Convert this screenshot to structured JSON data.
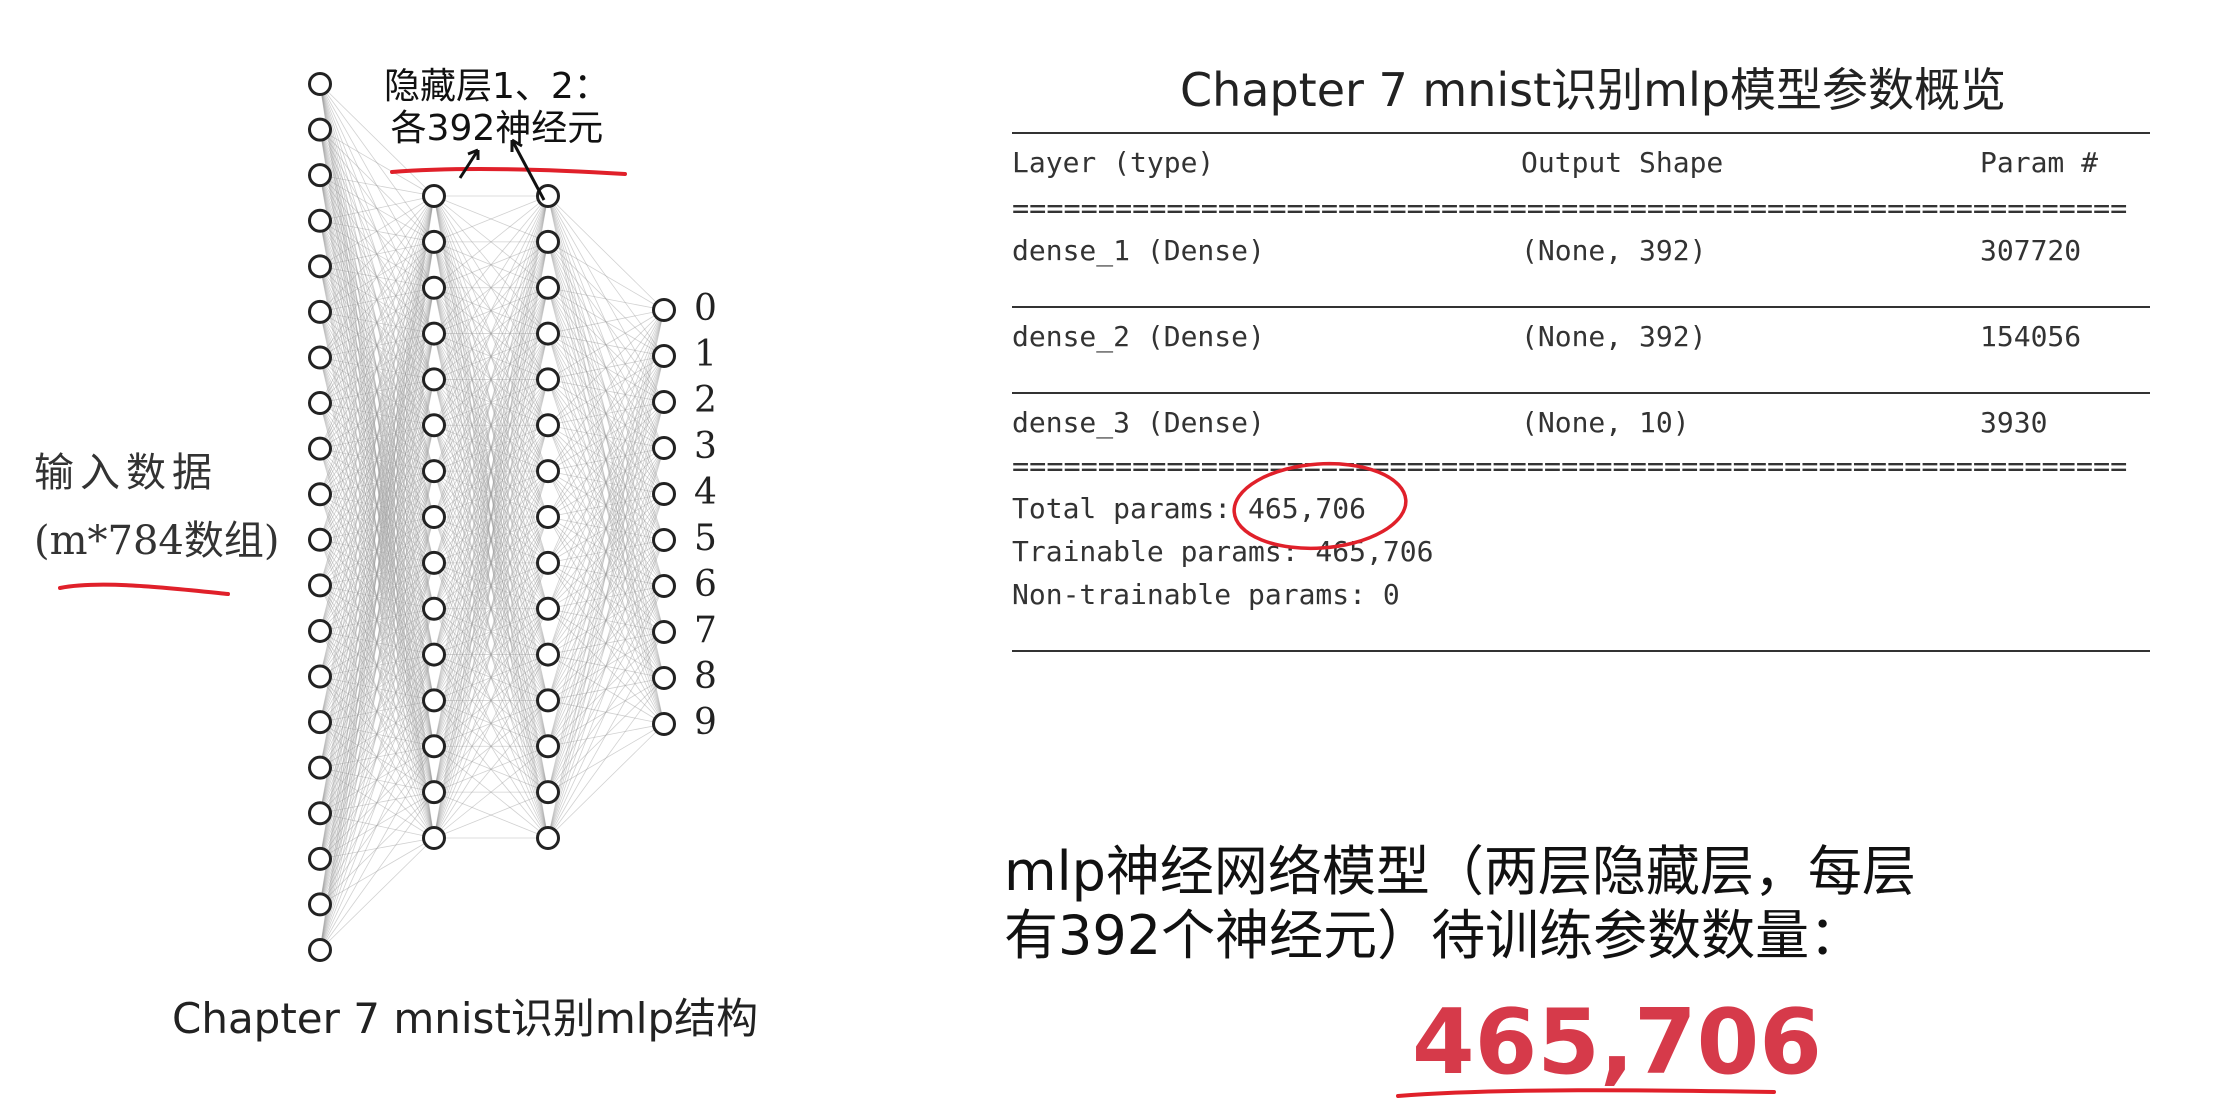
{
  "diagram": {
    "hidden_label_line1": "隐藏层1、2：",
    "hidden_label_line2": "各392神经元",
    "input_label_line1": "输入数据",
    "input_label_line2": "(m*784数组)",
    "output_labels": [
      "0",
      "1",
      "2",
      "3",
      "4",
      "5",
      "6",
      "7",
      "8",
      "9"
    ],
    "caption": "Chapter 7 mnist识别mlp结构"
  },
  "model_summary": {
    "title": "Chapter 7 mnist识别mlp模型参数概览",
    "headers": [
      "Layer (type)",
      "Output Shape",
      "Param #"
    ],
    "separator": "=================================================================",
    "rows": [
      [
        "dense_1 (Dense)",
        "(None, 392)",
        "307720"
      ],
      [
        "dense_2 (Dense)",
        "(None, 392)",
        "154056"
      ],
      [
        "dense_3 (Dense)",
        "(None, 10)",
        "3930"
      ]
    ],
    "total_params": "Total params: 465,706",
    "trainable_params": "Trainable params: 465,706",
    "non_trainable_params": "Non-trainable params: 0"
  },
  "conclusion": {
    "line1": "mlp神经网络模型（两层隐藏层，每层",
    "line2": "有392个神经元）待训练参数数量：",
    "number": "465,706"
  },
  "colors": {
    "annotation_red": "#e0202a",
    "number_red": "#d63a4a",
    "node_stroke": "#222222",
    "edge": "#9a9a9a"
  }
}
